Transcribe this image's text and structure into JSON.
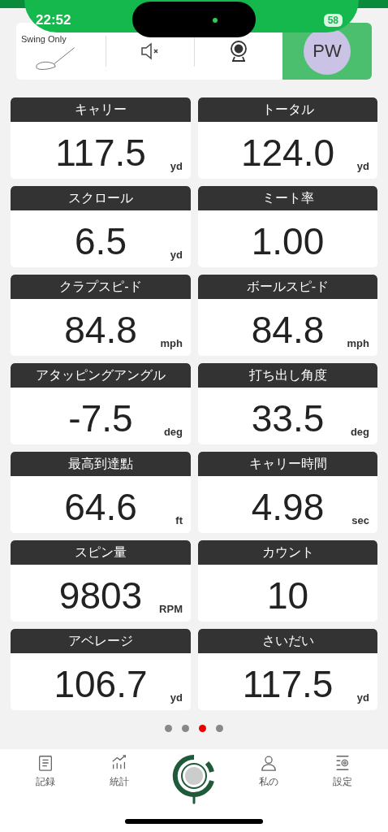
{
  "status_bar": {
    "time": "22:52",
    "battery": "58"
  },
  "toolbar": {
    "mode_label": "Swing Only",
    "muted": true,
    "club": "PW"
  },
  "metrics": [
    {
      "label": "キャリー",
      "value": "117.5",
      "unit": "yd"
    },
    {
      "label": "トータル",
      "value": "124.0",
      "unit": "yd"
    },
    {
      "label": "スクロール",
      "value": "6.5",
      "unit": "yd"
    },
    {
      "label": "ミート率",
      "value": "1.00"
    },
    {
      "label": "クラプスピ-ド",
      "value": "84.8",
      "unit": "mph"
    },
    {
      "label": "ボールスピ-ド",
      "value": "84.8",
      "unit": "mph"
    },
    {
      "label": "アタッピングアングル",
      "value": "-7.5",
      "unit": "deg"
    },
    {
      "label": "打ち出し角度",
      "value": "33.5",
      "unit": "deg"
    },
    {
      "label": "最高到達點",
      "value": "64.6",
      "unit": "ft"
    },
    {
      "label": "キャリー時間",
      "value": "4.98",
      "unit": "sec"
    },
    {
      "label": "スピン量",
      "value": "9803",
      "unit": "RPM"
    },
    {
      "label": "カウント",
      "value": "10"
    },
    {
      "label": "アベレージ",
      "value": "106.7",
      "unit": "yd"
    },
    {
      "label": "さいだい",
      "value": "117.5",
      "unit": "yd"
    }
  ],
  "pages": [
    {
      "selected": false
    },
    {
      "selected": false
    },
    {
      "selected": true
    },
    {
      "selected": false
    }
  ],
  "nav": [
    {
      "kind": "record",
      "label": "記録"
    },
    {
      "kind": "stats",
      "label": "統計"
    },
    {
      "kind": "center"
    },
    {
      "kind": "me",
      "label": "私の"
    },
    {
      "kind": "settings",
      "label": "設定"
    }
  ]
}
